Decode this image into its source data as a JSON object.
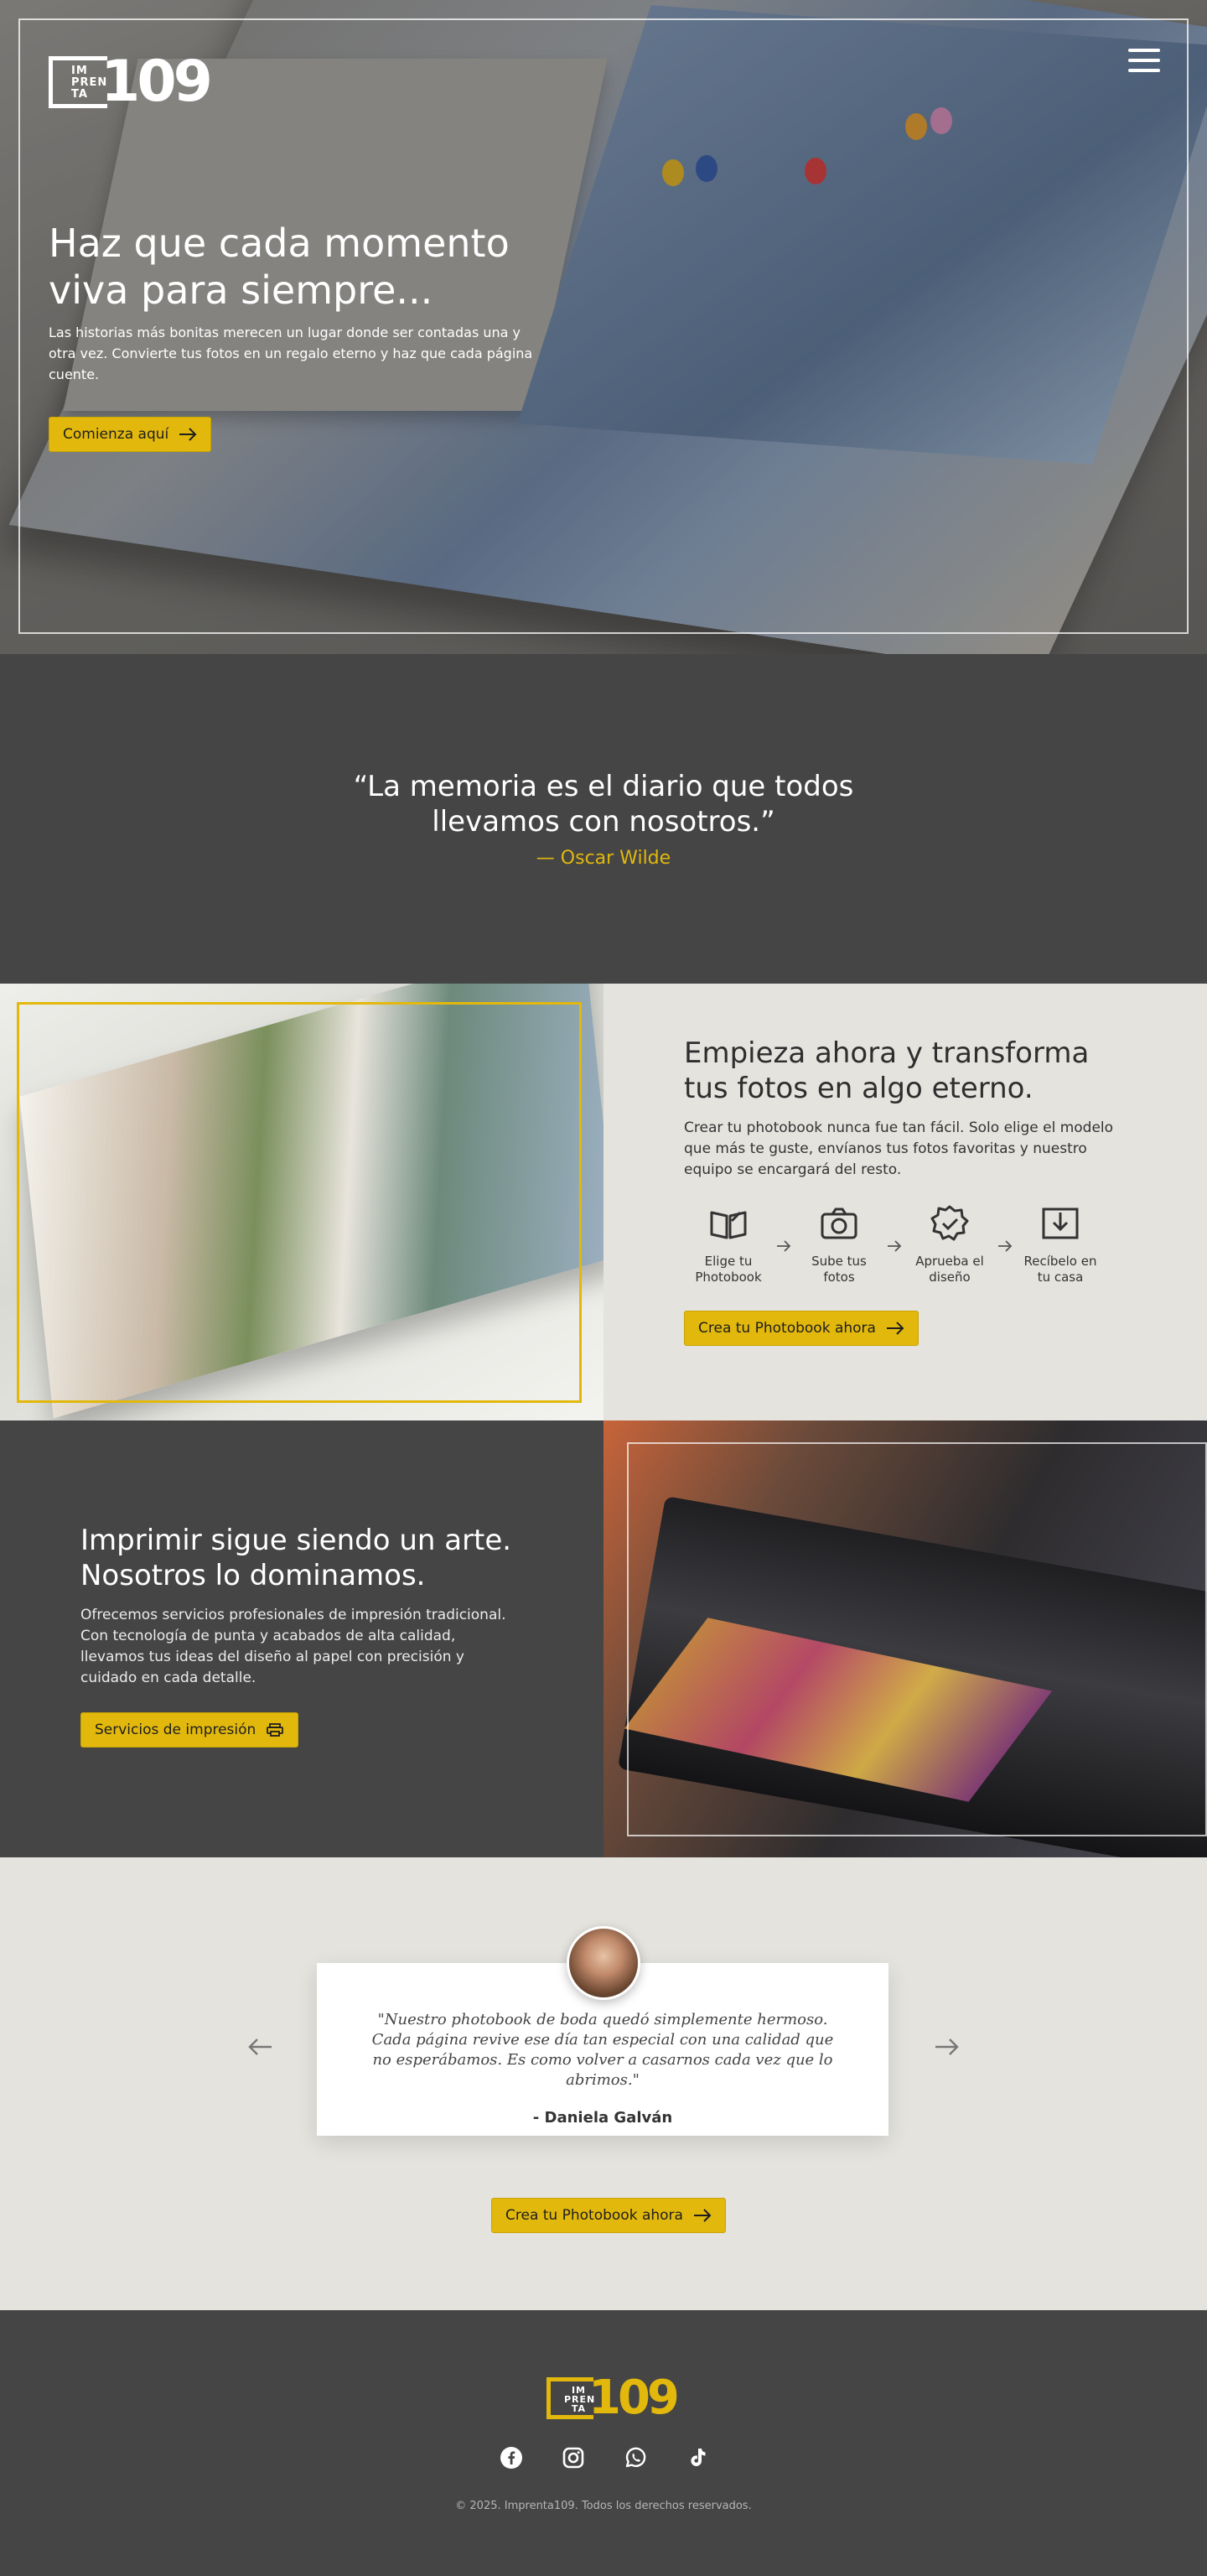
{
  "brand": {
    "logo_letters": "IM PREN TA",
    "logo_number": "109",
    "accent_color": "#e2b80d",
    "dark_bg": "#444544",
    "light_bg": "#e4e3de"
  },
  "header": {
    "menu_icon": "hamburger-menu-icon"
  },
  "hero": {
    "title": "Haz que cada momento viva para siempre...",
    "text": "Las historias más bonitas merecen un lugar donde ser contadas una y otra vez. Convierte tus fotos en un regalo eterno y haz que cada página cuente.",
    "cta": "Comienza aquí"
  },
  "quote": {
    "text": "“La memoria es el diario que todos llevamos con nosotros.”",
    "author": "— Oscar Wilde"
  },
  "photobook": {
    "title": "Empieza ahora y transforma tus fotos en algo eterno.",
    "text": "Crear tu photobook nunca fue tan fácil. Solo elige el modelo que más te guste, envíanos tus fotos favoritas y nuestro equipo se encargará del resto.",
    "steps": [
      {
        "label": "Elige tu Photobook",
        "icon": "open-book-icon"
      },
      {
        "label": "Sube tus fotos",
        "icon": "camera-icon"
      },
      {
        "label": "Aprueba el diseño",
        "icon": "approved-badge-icon"
      },
      {
        "label": "Recíbelo en tu casa",
        "icon": "download-box-icon"
      }
    ],
    "cta": "Crea tu Photobook ahora"
  },
  "printing": {
    "title": "Imprimir sigue siendo un arte. Nosotros lo dominamos.",
    "text": "Ofrecemos servicios profesionales de impresión tradicional. Con tecnología de punta y acabados de alta calidad, llevamos tus ideas del diseño al papel con precisión y cuidado en cada detalle.",
    "cta": "Servicios de impresión"
  },
  "testimonial": {
    "text": "\"Nuestro photobook de boda quedó simplemente hermoso. Cada página revive ese día tan especial con una calidad que no esperábamos. Es como volver a casarnos cada vez que lo abrimos.\"",
    "name": "- Daniela Galván",
    "cta": "Crea tu Photobook ahora"
  },
  "footer": {
    "socials": [
      "facebook-icon",
      "instagram-icon",
      "whatsapp-icon",
      "tiktok-icon"
    ],
    "copyright": "© 2025. Imprenta109. Todos los derechos reservados."
  }
}
